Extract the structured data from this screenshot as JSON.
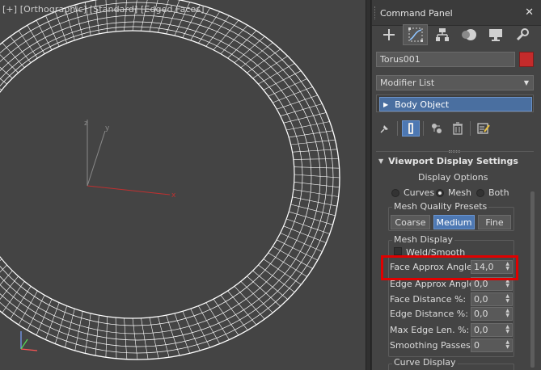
{
  "viewport": {
    "label": "[+] [Orthographic] [Standard] [Edged Faces]",
    "axes": {
      "x": "x",
      "y": "y",
      "z": "z"
    },
    "colors": {
      "background": "#444444",
      "mesh": "#ffffff",
      "x_axis": "#c03030",
      "y_axis": "#909090",
      "z_axis": "#909090"
    }
  },
  "panel": {
    "title": "Command Panel",
    "close_glyph": "✕",
    "tabs": [
      {
        "name": "create-tab",
        "icon": "plus-icon"
      },
      {
        "name": "modify-tab",
        "icon": "modify-curve-icon"
      },
      {
        "name": "hierarchy-tab",
        "icon": "hierarchy-icon"
      },
      {
        "name": "motion-tab",
        "icon": "motion-icon"
      },
      {
        "name": "display-tab",
        "icon": "monitor-icon"
      },
      {
        "name": "utilities-tab",
        "icon": "wrench-icon"
      }
    ],
    "object_name": "Torus001",
    "object_color": "#c42b2b",
    "modifier_list": "Modifier List",
    "stack_item": "Body Object",
    "rollout": {
      "title": "Viewport Display Settings",
      "display_options": "Display Options",
      "radios": {
        "curves": "Curves",
        "mesh": "Mesh",
        "both": "Both",
        "selected": "mesh"
      },
      "mesh_quality_presets": "Mesh Quality Presets",
      "presets": {
        "coarse": "Coarse",
        "medium": "Medium",
        "fine": "Fine",
        "selected": "medium"
      },
      "mesh_display": "Mesh Display",
      "weld_smooth": "Weld/Smooth",
      "fields": {
        "face_approx_angle": {
          "label": "Face Approx Angle:",
          "value": "14,0"
        },
        "edge_approx_angle": {
          "label": "Edge Approx Angle:",
          "value": "0,0"
        },
        "face_distance": {
          "label": "Face Distance %:",
          "value": "0,0"
        },
        "edge_distance": {
          "label": "Edge Distance %:",
          "value": "0,0"
        },
        "max_edge_len": {
          "label": "Max Edge Len. %:",
          "value": "0,0"
        },
        "smoothing_passes": {
          "label": "Smoothing Passes:",
          "value": "0"
        }
      },
      "curve_display": "Curve Display"
    },
    "highlight_color": "#e00000"
  }
}
